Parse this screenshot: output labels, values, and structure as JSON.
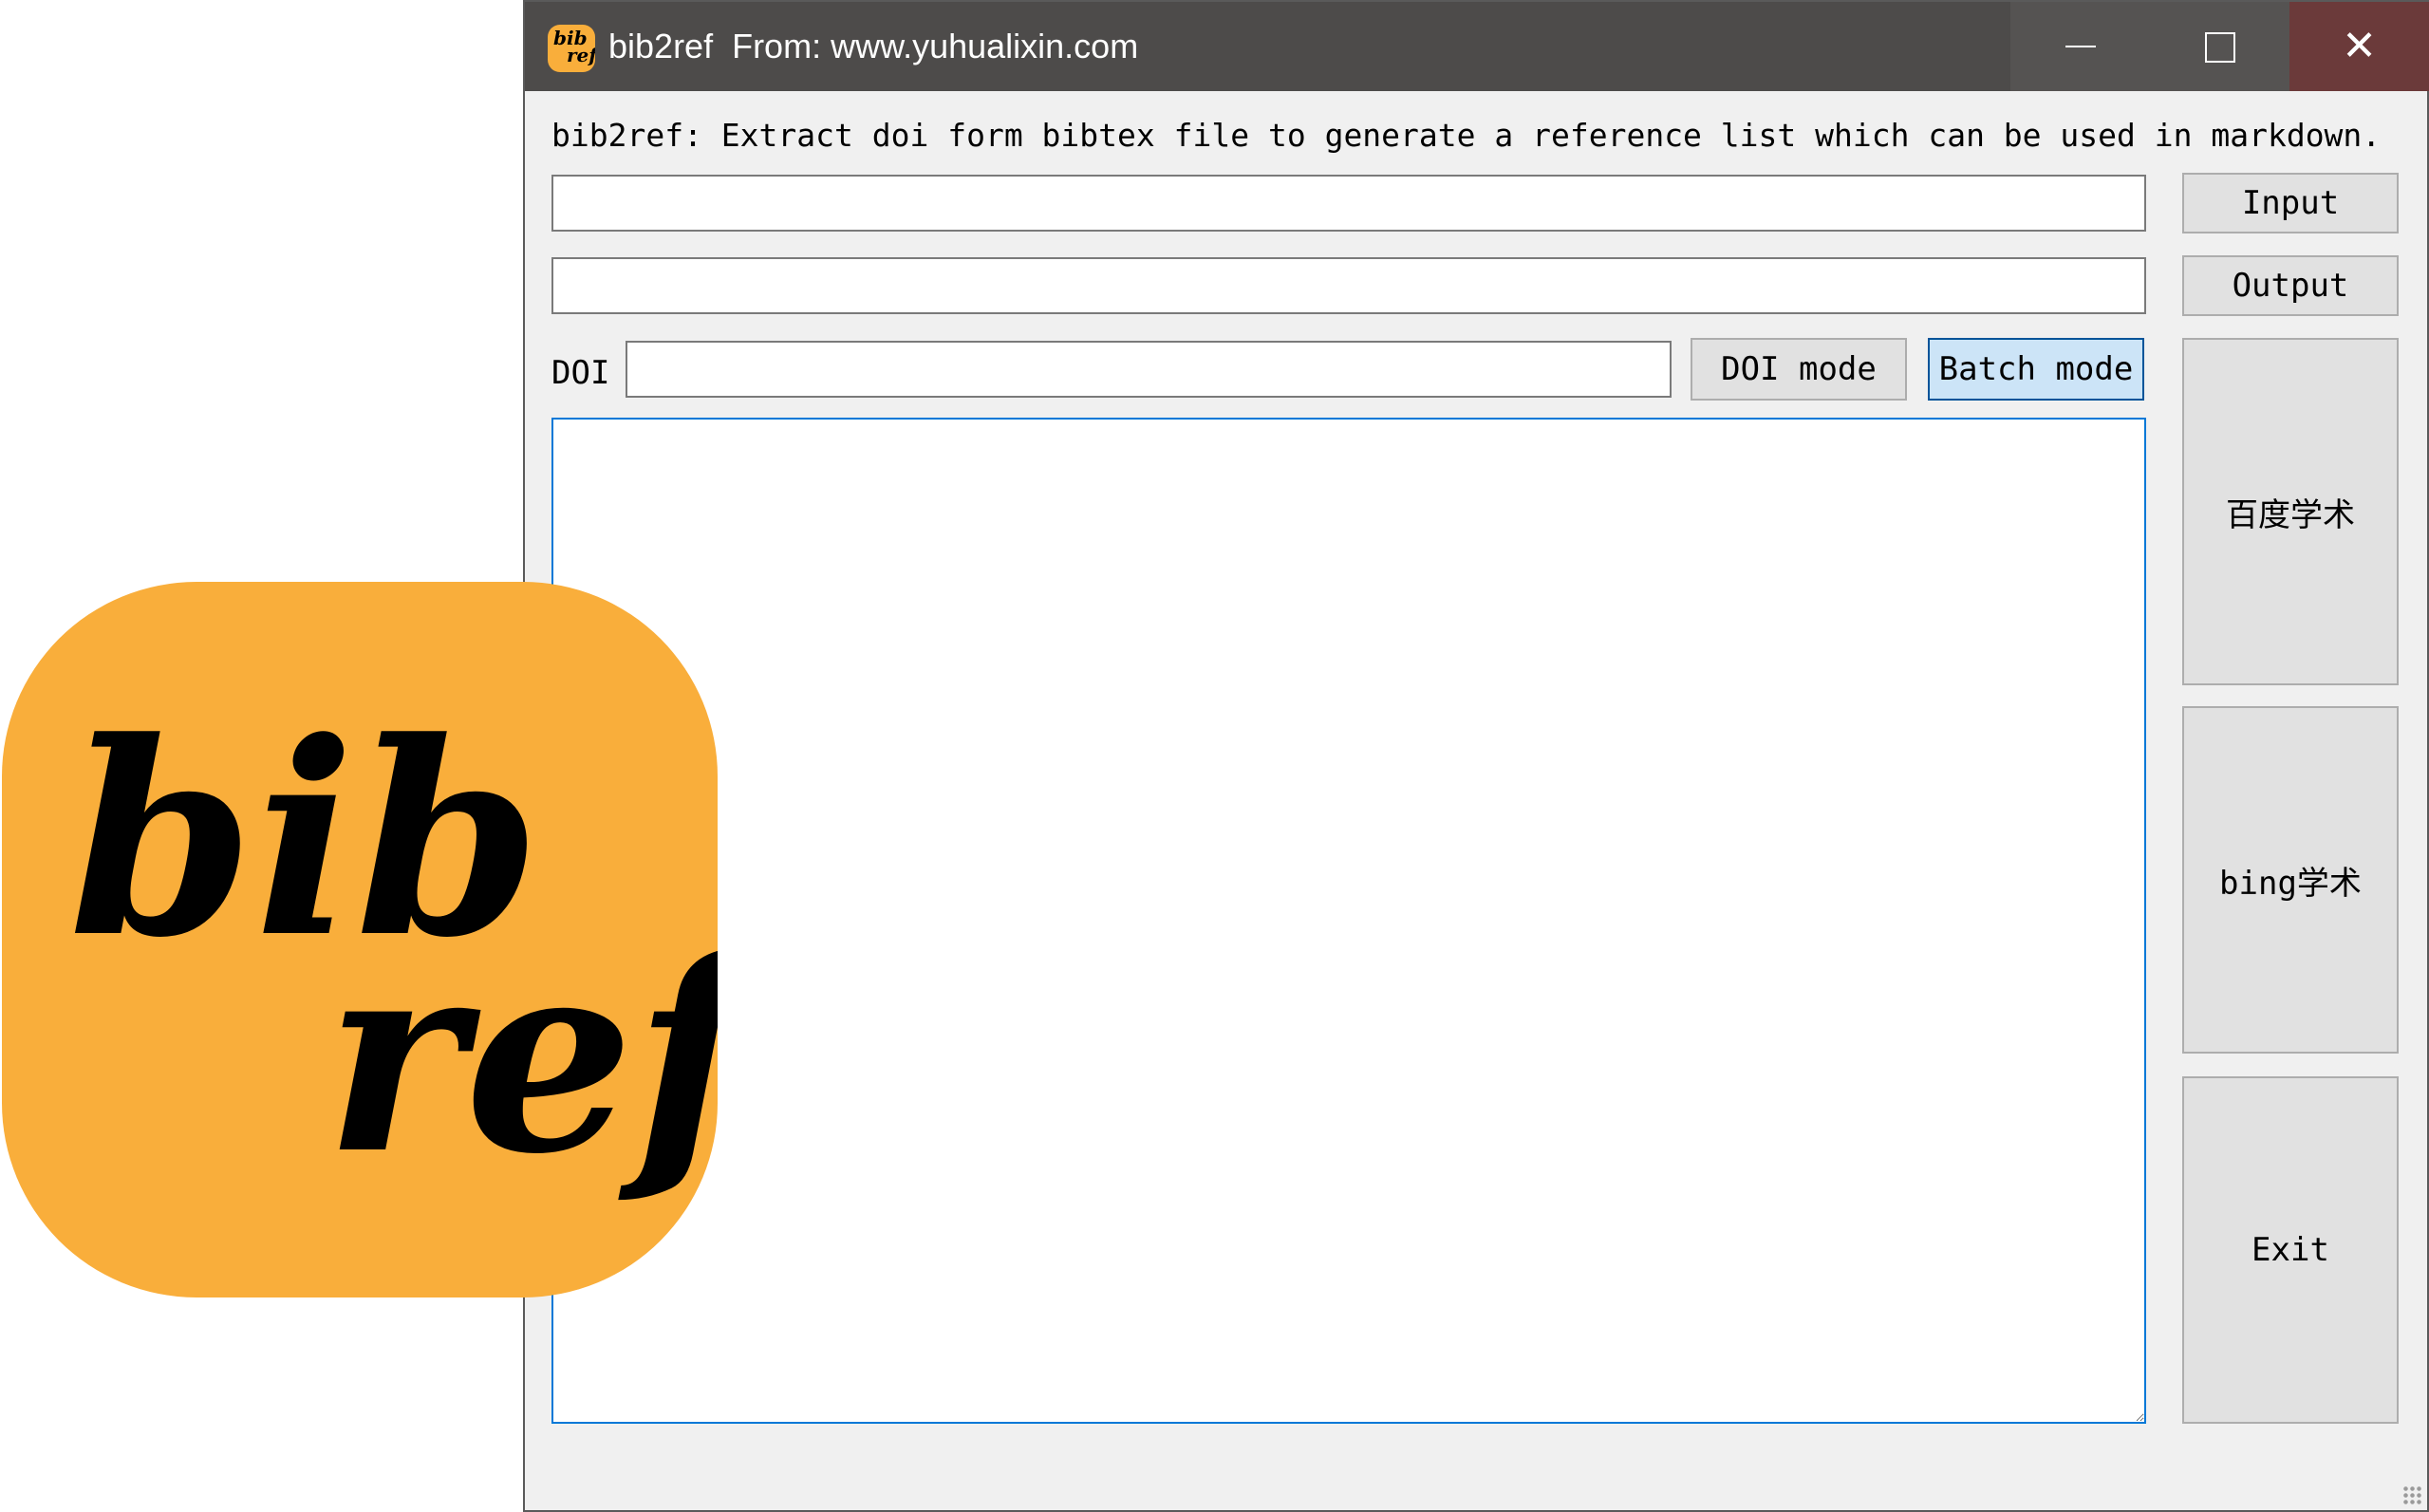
{
  "window": {
    "title": "bib2ref  From: www.yuhualixin.com",
    "controls": {
      "minimize": "—",
      "maximize": "☐",
      "close": "✕"
    }
  },
  "app_icon": {
    "name": "bib-ref-logo-icon",
    "line1": "bib",
    "line2": "ref",
    "color": "#f9ae3b"
  },
  "description": "bib2ref: Extract doi form bibtex file to generate a reference list which can be used in markdown.",
  "input_path": {
    "value": ""
  },
  "output_path": {
    "value": ""
  },
  "buttons": {
    "input": "Input",
    "output": "Output",
    "doi_mode": "DOI mode",
    "batch_mode": "Batch mode",
    "baidu": "百度学术",
    "bing": "bing学术",
    "exit": "Exit"
  },
  "doi": {
    "label": "DOI",
    "value": ""
  },
  "result_text": "",
  "logo": {
    "line1": "bib",
    "line2": "ref",
    "color": "#f9ae3b"
  },
  "colors": {
    "titlebar": "#4d4b4a",
    "accent": "#0078d7",
    "active_button": "#cce4f7"
  }
}
